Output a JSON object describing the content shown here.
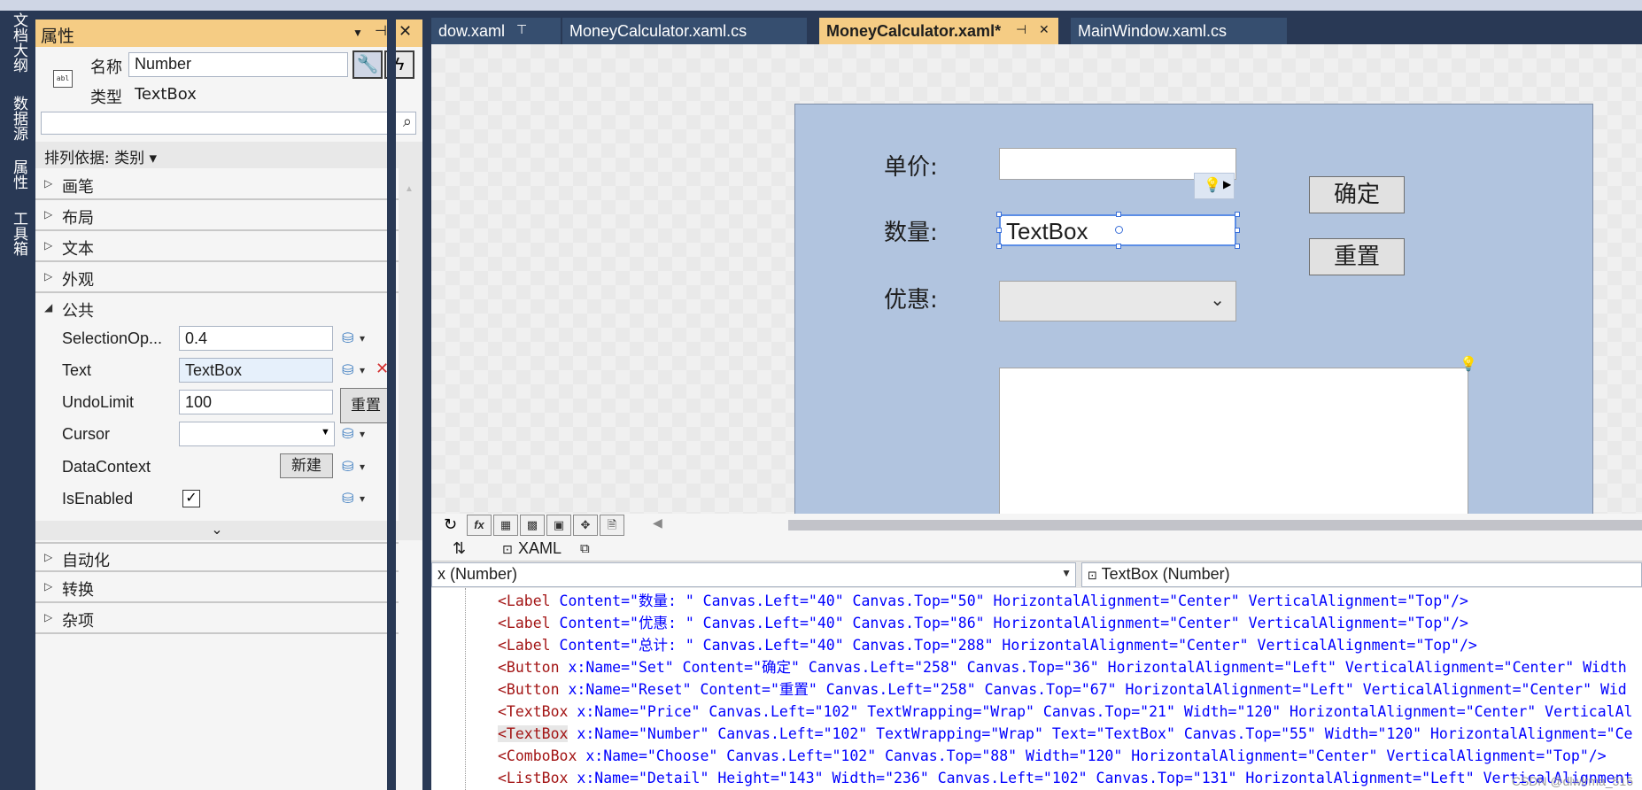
{
  "side_tabs": [
    "文档大纲",
    "数据源",
    "属性",
    "工具箱"
  ],
  "properties_panel": {
    "title": "属性",
    "name_label": "名称",
    "name_value": "Number",
    "type_label": "类型",
    "type_value": "TextBox",
    "sort_label": "排列依据: 类别 ▾",
    "categories_top": [
      "画笔",
      "布局",
      "文本",
      "外观"
    ],
    "common_label": "公共",
    "props": {
      "selection_opacity_label": "SelectionOp...",
      "selection_opacity_value": "0.4",
      "text_label": "Text",
      "text_value": "TextBox",
      "undo_label": "UndoLimit",
      "undo_value": "100",
      "reset_btn": "重置",
      "cursor_label": "Cursor",
      "cursor_value": "",
      "datacontext_label": "DataContext",
      "new_btn": "新建",
      "isenabled_label": "IsEnabled",
      "isenabled_checked": "✓"
    },
    "categories_bottom": [
      "自动化",
      "转换",
      "杂项"
    ]
  },
  "doc_tabs": [
    {
      "label": "dow.xaml"
    },
    {
      "label": "MoneyCalculator.xaml.cs"
    },
    {
      "label": "MoneyCalculator.xaml*"
    },
    {
      "label": "MainWindow.xaml.cs"
    }
  ],
  "designer": {
    "price_label": "单价:",
    "qty_label": "数量:",
    "qty_value": "TextBox",
    "discount_label": "优惠:",
    "confirm_btn": "确定",
    "reset_btn": "重置"
  },
  "split_tabs": {
    "swap": "⇅",
    "xaml": "XAML"
  },
  "nav": {
    "left": "x (Number)",
    "right": "TextBox (Number)"
  },
  "code_lines": [
    {
      "tag": "<Label",
      "rest": " Content=\"数量: \" Canvas.Left=\"40\" Canvas.Top=\"50\" HorizontalAlignment=\"Center\" VerticalAlignment=\"Top\"/>"
    },
    {
      "tag": "<Label",
      "rest": " Content=\"优惠: \" Canvas.Left=\"40\" Canvas.Top=\"86\" HorizontalAlignment=\"Center\" VerticalAlignment=\"Top\"/>"
    },
    {
      "tag": "<Label",
      "rest": " Content=\"总计: \" Canvas.Left=\"40\" Canvas.Top=\"288\" HorizontalAlignment=\"Center\" VerticalAlignment=\"Top\"/>"
    },
    {
      "tag": "<Button",
      "rest": " x:Name=\"Set\" Content=\"确定\" Canvas.Left=\"258\" Canvas.Top=\"36\" HorizontalAlignment=\"Left\" VerticalAlignment=\"Center\" Width"
    },
    {
      "tag": "<Button",
      "rest": " x:Name=\"Reset\" Content=\"重置\" Canvas.Left=\"258\" Canvas.Top=\"67\" HorizontalAlignment=\"Left\" VerticalAlignment=\"Center\" Wid"
    },
    {
      "tag": "<TextBox",
      "rest": " x:Name=\"Price\" Canvas.Left=\"102\" TextWrapping=\"Wrap\" Canvas.Top=\"21\" Width=\"120\" HorizontalAlignment=\"Center\" VerticalAl"
    },
    {
      "tag": "<TextBox",
      "rest": " x:Name=\"Number\" Canvas.Left=\"102\" TextWrapping=\"Wrap\" Text=\"TextBox\" Canvas.Top=\"55\" Width=\"120\" HorizontalAlignment=\"Ce"
    },
    {
      "tag": "<ComboBox",
      "rest": " x:Name=\"Choose\" Canvas.Left=\"102\" Canvas.Top=\"88\" Width=\"120\" HorizontalAlignment=\"Center\" VerticalAlignment=\"Top\"/>"
    },
    {
      "tag": "<ListBox",
      "rest": " x:Name=\"Detail\" Height=\"143\" Width=\"236\" Canvas.Left=\"102\" Canvas.Top=\"131\" HorizontalAlignment=\"Left\" VerticalAlignment"
    }
  ],
  "watermark": "CSDN @dlwlrma_516",
  "colors": {
    "chrome": "#293955",
    "active_tab": "#f5cc84",
    "canvas": "#b1c4df",
    "selection": "#5c8ee6"
  }
}
